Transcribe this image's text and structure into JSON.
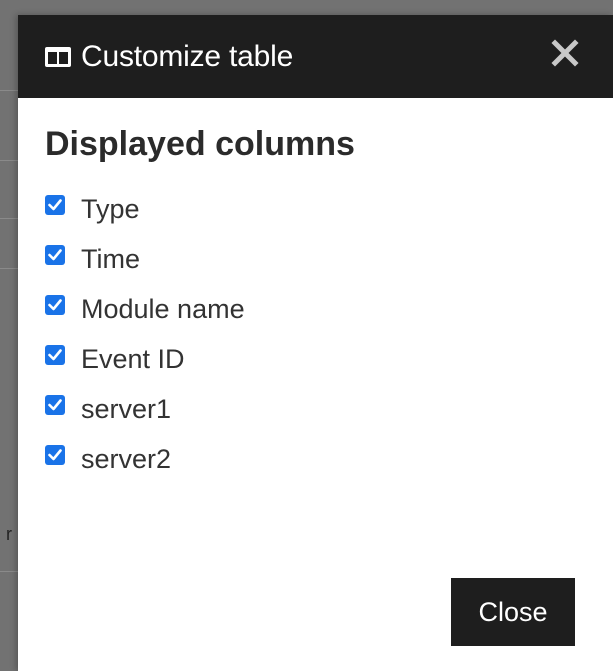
{
  "dialog": {
    "title": "Customize table",
    "header_icon": "columns-icon",
    "close_icon": "close-icon",
    "section_title": "Displayed columns",
    "columns": [
      {
        "label": "Type",
        "checked": true
      },
      {
        "label": "Time",
        "checked": true
      },
      {
        "label": "Module name",
        "checked": true
      },
      {
        "label": "Event ID",
        "checked": true
      },
      {
        "label": "server1",
        "checked": true
      },
      {
        "label": "server2",
        "checked": true
      }
    ],
    "close_button_label": "Close"
  },
  "background_fragment": "r",
  "colors": {
    "header_bg": "#1e1e1e",
    "checkbox_accent": "#1a73e8",
    "overlay": "#727272"
  }
}
